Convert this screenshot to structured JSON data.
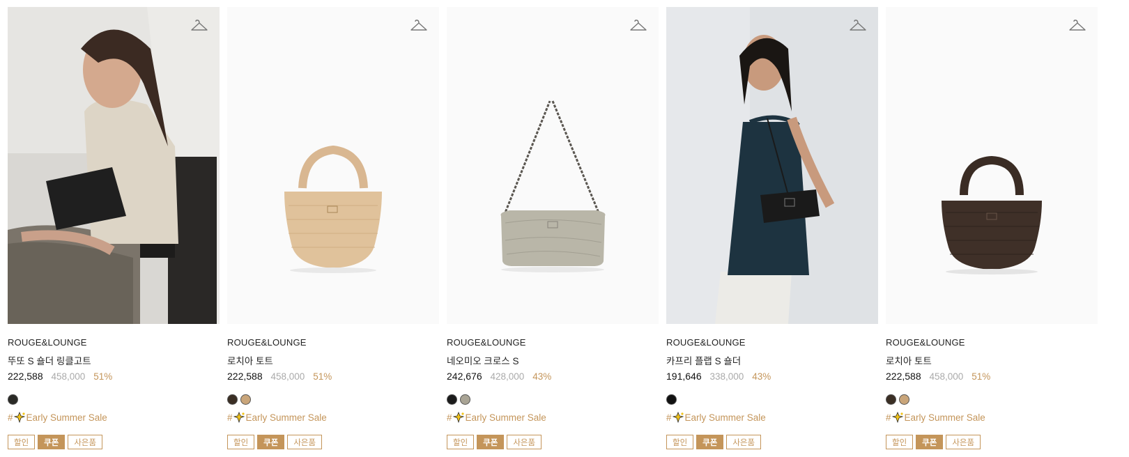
{
  "products": [
    {
      "brand": "ROUGE&LOUNGE",
      "title": "뚜또 S 숄더 링클고트",
      "price": "222,588",
      "original_price": "458,000",
      "discount": "51%",
      "swatches": [
        "#2a2a26"
      ],
      "tag_hash": "#",
      "tag_text": "Early Summer Sale",
      "badges": [
        "할인",
        "쿠폰",
        "사은품"
      ],
      "icon": "hanger-icon"
    },
    {
      "brand": "ROUGE&LOUNGE",
      "title": "로치아 토트",
      "price": "222,588",
      "original_price": "458,000",
      "discount": "51%",
      "swatches": [
        "#3a2e24",
        "#c9a57a"
      ],
      "tag_hash": "#",
      "tag_text": "Early Summer Sale",
      "badges": [
        "할인",
        "쿠폰",
        "사은품"
      ],
      "icon": "hanger-icon"
    },
    {
      "brand": "ROUGE&LOUNGE",
      "title": "네오미오 크로스 S",
      "price": "242,676",
      "original_price": "428,000",
      "discount": "43%",
      "swatches": [
        "#1b1b1b",
        "#a9a495"
      ],
      "tag_hash": "#",
      "tag_text": "Early Summer Sale",
      "badges": [
        "할인",
        "쿠폰",
        "사은품"
      ],
      "icon": "hanger-icon"
    },
    {
      "brand": "ROUGE&LOUNGE",
      "title": "카프리 플랩 S 숄더",
      "price": "191,646",
      "original_price": "338,000",
      "discount": "43%",
      "swatches": [
        "#111111"
      ],
      "tag_hash": "#",
      "tag_text": "Early Summer Sale",
      "badges": [
        "할인",
        "쿠폰",
        "사은품"
      ],
      "icon": "hanger-icon"
    },
    {
      "brand": "ROUGE&LOUNGE",
      "title": "로치아 토트",
      "price": "222,588",
      "original_price": "458,000",
      "discount": "51%",
      "swatches": [
        "#3a2e24",
        "#c9a57a"
      ],
      "tag_hash": "#",
      "tag_text": "Early Summer Sale",
      "badges": [
        "할인",
        "쿠폰",
        "사은품"
      ],
      "icon": "hanger-icon"
    }
  ],
  "colors": {
    "accent": "#c4955a",
    "muted": "#aaaaaa",
    "text": "#222222"
  }
}
